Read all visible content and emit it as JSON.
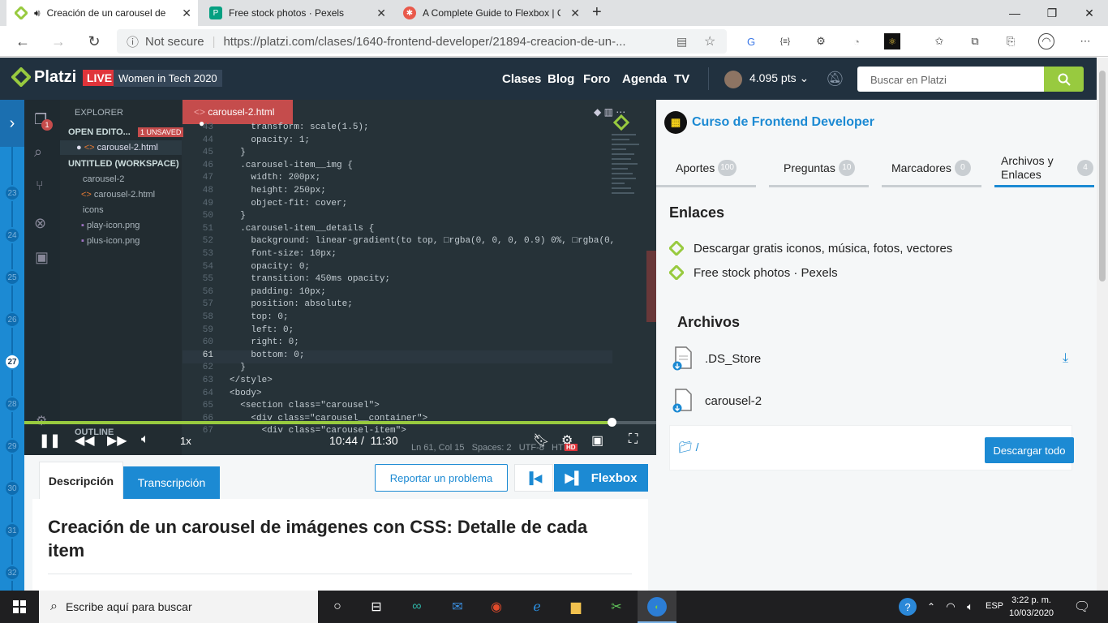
{
  "browser": {
    "tabs": [
      {
        "title": "Creación de un carousel de",
        "color": "#98ca3f"
      },
      {
        "title": "Free stock photos · Pexels",
        "color": "#05a081"
      },
      {
        "title": "A Complete Guide to Flexbox | C",
        "color": "#e9594b"
      }
    ],
    "new_tab": "+",
    "address": {
      "security": "Not secure",
      "url": "https://platzi.com/clases/1640-frontend-developer/21894-creacion-de-un-..."
    }
  },
  "header": {
    "logo": "Platzi",
    "live": "LIVE",
    "event": "Women in Tech 2020",
    "nav": [
      "Clases",
      "Blog",
      "Foro",
      "Agenda",
      "TV"
    ],
    "points": "4.095 pts",
    "search_placeholder": "Buscar en Platzi"
  },
  "timeline": {
    "numbers": [
      "23",
      "24",
      "25",
      "26",
      "27",
      "28",
      "29",
      "30",
      "31",
      "32"
    ],
    "current": "27"
  },
  "video": {
    "explorer": {
      "title": "EXPLORER",
      "open_editors": "OPEN EDITO...",
      "unsaved": "1 UNSAVED",
      "open_file": "carousel-2.html",
      "workspace": "UNTITLED (WORKSPACE)",
      "folder1": "carousel-2",
      "file1": "carousel-2.html",
      "folder2": "icons",
      "file2": "play-icon.png",
      "file3": "plus-icon.png",
      "outline": "OUTLINE"
    },
    "editor_tab": "carousel-2.html",
    "code": [
      {
        "ln": "43",
        "text": "    transform: scale(1.5);"
      },
      {
        "ln": "44",
        "text": "    opacity: 1;"
      },
      {
        "ln": "45",
        "text": "  }"
      },
      {
        "ln": "46",
        "text": "  .carousel-item__img {"
      },
      {
        "ln": "47",
        "text": "    width: 200px;"
      },
      {
        "ln": "48",
        "text": "    height: 250px;"
      },
      {
        "ln": "49",
        "text": "    object-fit: cover;"
      },
      {
        "ln": "50",
        "text": "  }"
      },
      {
        "ln": "51",
        "text": "  .carousel-item__details {"
      },
      {
        "ln": "52",
        "text": "    background: linear-gradient(to top, □rgba(0, 0, 0, 0.9) 0%, □rgba(0,"
      },
      {
        "ln": "53",
        "text": "    font-size: 10px;"
      },
      {
        "ln": "54",
        "text": "    opacity: 0;"
      },
      {
        "ln": "55",
        "text": "    transition: 450ms opacity;"
      },
      {
        "ln": "56",
        "text": "    padding: 10px;"
      },
      {
        "ln": "57",
        "text": "    position: absolute;"
      },
      {
        "ln": "58",
        "text": "    top: 0;"
      },
      {
        "ln": "59",
        "text": "    left: 0;"
      },
      {
        "ln": "60",
        "text": "    right: 0;"
      },
      {
        "ln": "61",
        "text": "    bottom: 0;"
      },
      {
        "ln": "62",
        "text": "  }"
      },
      {
        "ln": "63",
        "text": "</style>"
      },
      {
        "ln": "64",
        "text": "<body>"
      },
      {
        "ln": "65",
        "text": "  <section class=\"carousel\">"
      },
      {
        "ln": "66",
        "text": "    <div class=\"carousel__container\">"
      },
      {
        "ln": "67",
        "text": "      <div class=\"carousel-item\">"
      }
    ],
    "current_line": "61",
    "status": {
      "pos": "Ln 61, Col 15",
      "spaces": "Spaces: 2",
      "enc": "UTF-8",
      "lang": "HTML"
    },
    "time_current": "10:44",
    "time_sep": "/",
    "time_total": "11:30",
    "speed": "1x",
    "progress": 0.93
  },
  "right": {
    "course": "Curso de Frontend Developer",
    "tabs": [
      {
        "label": "Aportes",
        "count": "100"
      },
      {
        "label": "Preguntas",
        "count": "10"
      },
      {
        "label": "Marcadores",
        "count": "0"
      },
      {
        "label": "Archivos y Enlaces",
        "count": "4"
      }
    ],
    "enlaces_title": "Enlaces",
    "links": [
      "Descargar gratis iconos, música, fotos, vectores",
      "Free stock photos · Pexels"
    ],
    "archivos_title": "Archivos",
    "files": [
      ".DS_Store",
      "carousel-2"
    ],
    "folder": "/",
    "download_all": "Descargar todo"
  },
  "below": {
    "tab_desc": "Descripción",
    "tab_trans": "Transcripción",
    "report": "Reportar un problema",
    "next": "Flexbox",
    "title": "Creación de un carousel de imágenes con CSS: Detalle de cada item"
  },
  "taskbar": {
    "search": "Escribe aquí para buscar",
    "lang": "ESP",
    "time": "3:22 p. m.",
    "date": "10/03/2020"
  },
  "colors": {
    "platzi_green": "#98ca3f",
    "platzi_blue": "#1c8ad3",
    "header_bg": "#21313f",
    "live_red": "#e0343a"
  }
}
